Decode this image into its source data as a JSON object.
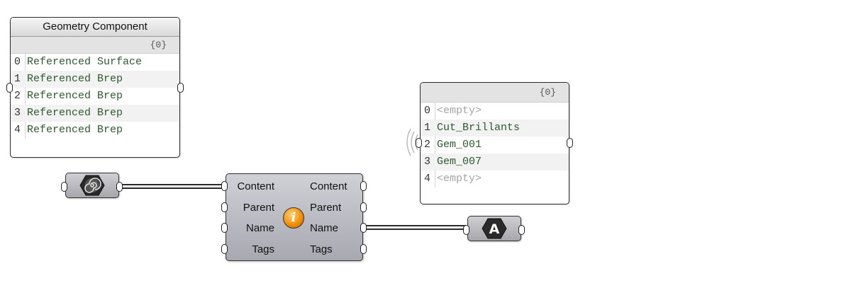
{
  "geometry_panel": {
    "title": "Geometry Component",
    "path": "{0}",
    "rows": [
      {
        "index": "0",
        "value": "Referenced Surface"
      },
      {
        "index": "1",
        "value": "Referenced Brep"
      },
      {
        "index": "2",
        "value": "Referenced Brep"
      },
      {
        "index": "3",
        "value": "Referenced Brep"
      },
      {
        "index": "4",
        "value": "Referenced Brep"
      }
    ]
  },
  "names_panel": {
    "path": "{0}",
    "rows": [
      {
        "index": "0",
        "value": "<empty>"
      },
      {
        "index": "1",
        "value": "Cut_Brillants"
      },
      {
        "index": "2",
        "value": "Gem_001"
      },
      {
        "index": "3",
        "value": "Gem_007"
      },
      {
        "index": "4",
        "value": "<empty>"
      }
    ]
  },
  "geometry_param": {
    "icon": "spiral-hexagon-icon"
  },
  "text_param": {
    "icon": "letter-a-hexagon-icon",
    "letter": "A"
  },
  "content_component": {
    "icon": "info-icon",
    "icon_glyph": "i",
    "inputs": [
      "Content",
      "Parent",
      "Name",
      "Tags"
    ],
    "outputs": [
      "Content",
      "Parent",
      "Name",
      "Tags"
    ]
  },
  "colors": {
    "canvas": "#ffffff",
    "panel_text": "#2c5a2c",
    "empty_text": "#a4a4a4",
    "info_orange": "#f28a00"
  }
}
